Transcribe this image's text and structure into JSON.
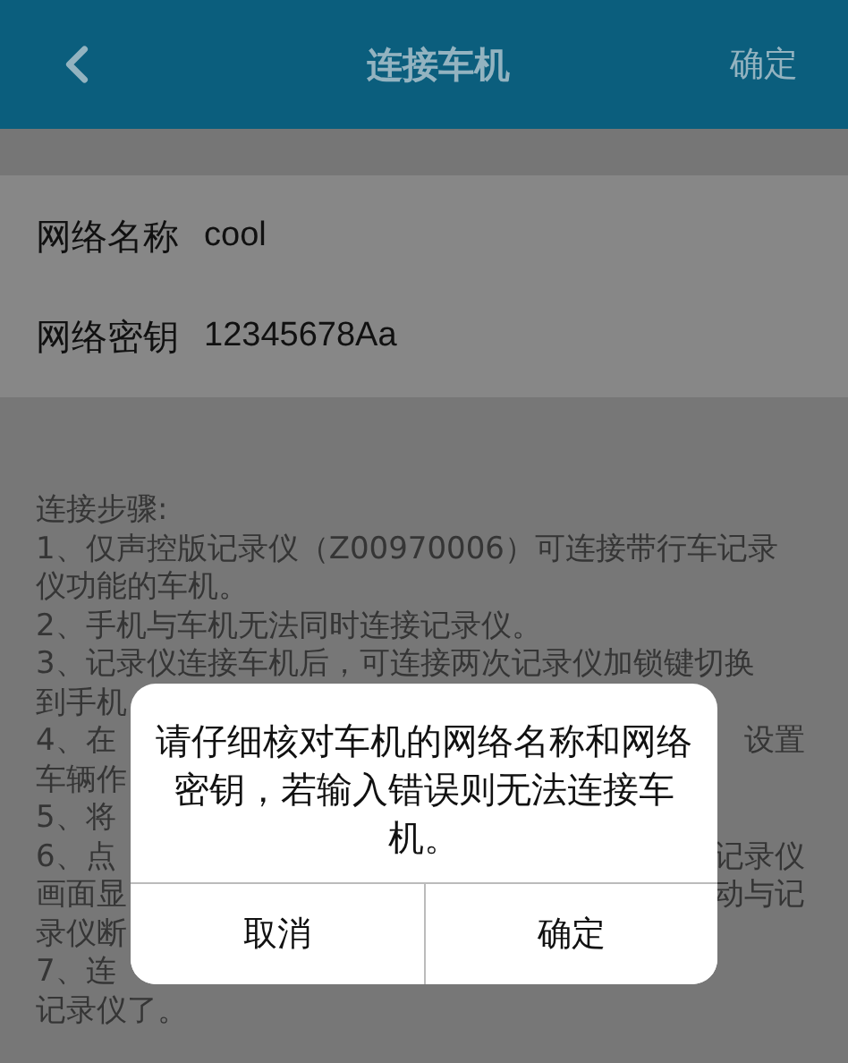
{
  "header": {
    "title": "连接车机",
    "action": "确定"
  },
  "fields": [
    {
      "label": "网络名称",
      "value": "cool"
    },
    {
      "label": "网络密钥",
      "value": "12345678Aa"
    }
  ],
  "steps": [
    {
      "left": "连接步骤:"
    },
    {
      "left": "1、仅声控版记录仪（Z00970006）可连接带行车记录"
    },
    {
      "left": "仪功能的车机。"
    },
    {
      "left": "2、手机与车机无法同时连接记录仪。"
    },
    {
      "left": "3、记录仪连接车机后，可连接两次记录仪加锁键切换"
    },
    {
      "left": "到手机"
    },
    {
      "left": "4、在",
      "right": "设置"
    },
    {
      "left": "车辆作"
    },
    {
      "left": "5、将"
    },
    {
      "left": "6、点",
      "right": "记录仪"
    },
    {
      "left": "画面显",
      "right": "动与记"
    },
    {
      "left": "录仪断"
    },
    {
      "left": "7、连"
    },
    {
      "left": "记录仪了。"
    }
  ],
  "dialog": {
    "message": "请仔细核对车机的网络名称和网络密钥，若输入错误则无法连接车机。",
    "buttons": [
      "取消",
      "确定"
    ]
  }
}
